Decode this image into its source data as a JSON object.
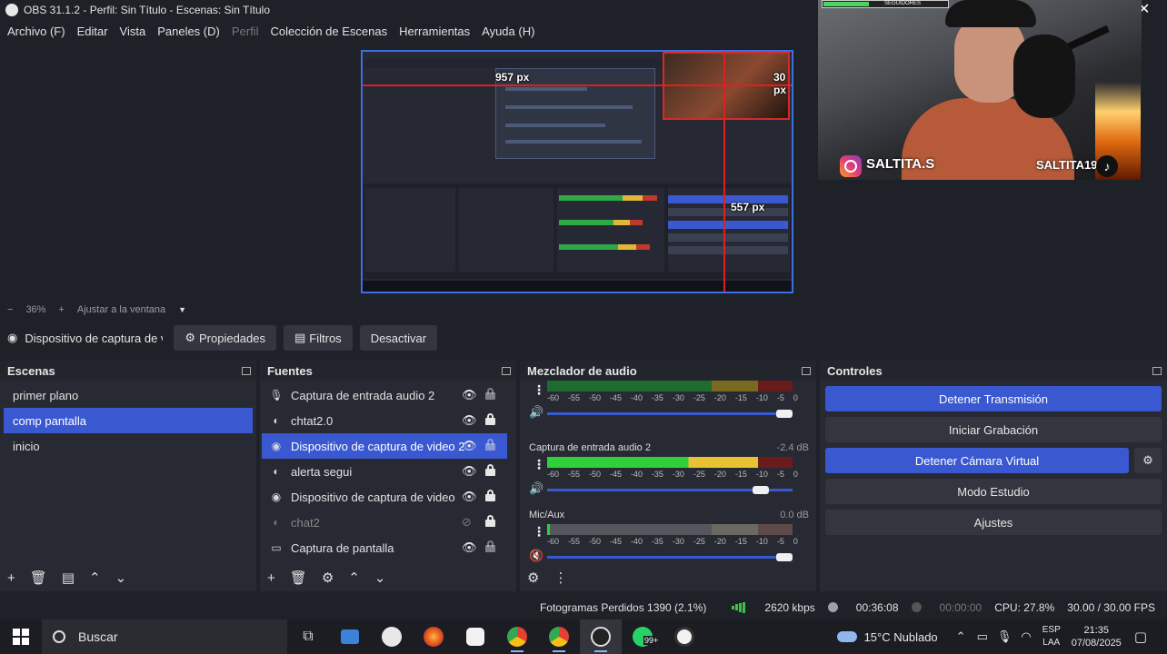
{
  "title": "OBS 31.1.2 - Perfil: Sin Título - Escenas: Sin Título",
  "menu": [
    "Archivo (F)",
    "Editar",
    "Vista",
    "Paneles (D)",
    "Perfil",
    "Colección de Escenas",
    "Herramientas",
    "Ayuda (H)"
  ],
  "preview": {
    "label_width": "957 px",
    "label_right": "30 px",
    "label_height": "557 px"
  },
  "webcam": {
    "handle_left": "SALTITA.S",
    "handle_right": "SALTITA19",
    "follow_bar": "SEGUIDORES"
  },
  "zoom": {
    "level": "36%",
    "fit": "Ajustar a la ventana"
  },
  "source_toolbar": {
    "source_name": "Dispositivo de captura de v",
    "properties": "Propiedades",
    "filters": "Filtros",
    "deactivate": "Desactivar"
  },
  "scenes": {
    "title": "Escenas",
    "items": [
      "primer plano",
      "comp pantalla",
      "inicio"
    ],
    "selected_index": 1
  },
  "sources": {
    "title": "Fuentes",
    "items": [
      {
        "label": "Captura de entrada audio 2",
        "icon": "mic-icon",
        "visible": true,
        "locked": false
      },
      {
        "label": "chtat2.0",
        "icon": "browser-icon",
        "visible": true,
        "locked": true
      },
      {
        "label": "Dispositivo de captura de video 2",
        "icon": "camera-icon",
        "visible": true,
        "locked": false
      },
      {
        "label": "alerta segui",
        "icon": "browser-icon",
        "visible": true,
        "locked": true
      },
      {
        "label": "Dispositivo de captura de video",
        "icon": "camera-icon",
        "visible": true,
        "locked": true
      },
      {
        "label": "chat2",
        "icon": "browser-icon",
        "visible": false,
        "locked": true
      },
      {
        "label": "Captura de pantalla",
        "icon": "monitor-icon",
        "visible": true,
        "locked": false
      }
    ],
    "selected_index": 2
  },
  "mixer": {
    "title": "Mezclador de audio",
    "ticks": [
      "-60",
      "-55",
      "-50",
      "-45",
      "-40",
      "-35",
      "-30",
      "-25",
      "-20",
      "-15",
      "-10",
      "-5",
      "0"
    ],
    "channels": [
      {
        "name": "",
        "db": "",
        "level": 0.0,
        "volume": 1.0
      },
      {
        "name": "Captura de entrada audio 2",
        "db": "-2.4 dB",
        "level": 0.86,
        "volume": 0.88,
        "muted": false
      },
      {
        "name": "Mic/Aux",
        "db": "0.0 dB",
        "level": 0.0,
        "volume": 1.0,
        "muted": true
      }
    ]
  },
  "controls": {
    "title": "Controles",
    "stop_stream": "Detener Transmisión",
    "start_recording": "Iniciar Grabación",
    "stop_virtual_cam": "Detener Cámara Virtual",
    "studio_mode": "Modo Estudio",
    "settings": "Ajustes"
  },
  "status": {
    "dropped_frames": "Fotogramas Perdidos 1390 (2.1%)",
    "bitrate": "2620 kbps",
    "stream_time": "00:36:08",
    "record_time": "00:00:00",
    "cpu": "CPU: 27.8%",
    "fps": "30.00 / 30.00 FPS"
  },
  "taskbar": {
    "search": "Buscar",
    "weather": "15°C  Nublado",
    "lang1": "ESP",
    "lang2": "LAA",
    "time": "21:35",
    "date": "07/08/2025",
    "badge": "99+"
  },
  "colors": {
    "accent": "#3a59d1",
    "bg": "#1f2128",
    "panel": "#272a33",
    "meter_green": "#2fd13a",
    "meter_yellow": "#e8c233",
    "meter_red": "#c0392b"
  }
}
